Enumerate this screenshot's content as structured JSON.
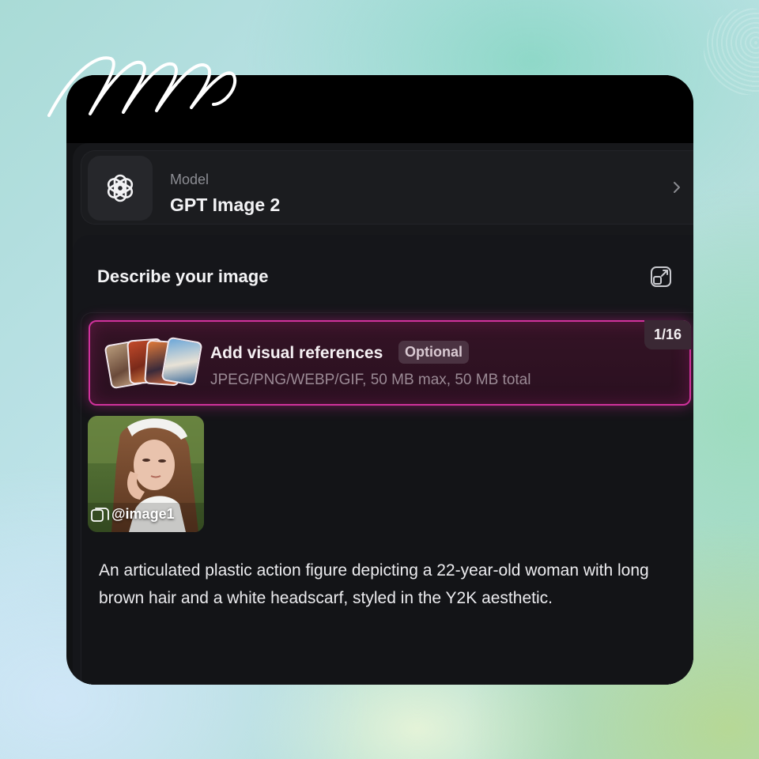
{
  "model": {
    "label": "Model",
    "name": "GPT Image 2",
    "logo_icon": "openai-logo-icon",
    "chevron_icon": "chevron-right-icon"
  },
  "prompt": {
    "title": "Describe your image",
    "expand_icon": "expand-icon",
    "text": "An articulated plastic action figure depicting a 22-year-old woman with long brown hair and a white headscarf, styled in the Y2K aesthetic."
  },
  "references": {
    "title": "Add visual references",
    "badge": "Optional",
    "formats": "JPEG/PNG/WEBP/GIF, 50 MB max, 50 MB total",
    "count": "1/16"
  },
  "attachments": [
    {
      "tag": "@image1"
    }
  ],
  "colors": {
    "accent_border": "#d0329c",
    "panel_bg": "#17181b",
    "window_bg": "#111214"
  }
}
